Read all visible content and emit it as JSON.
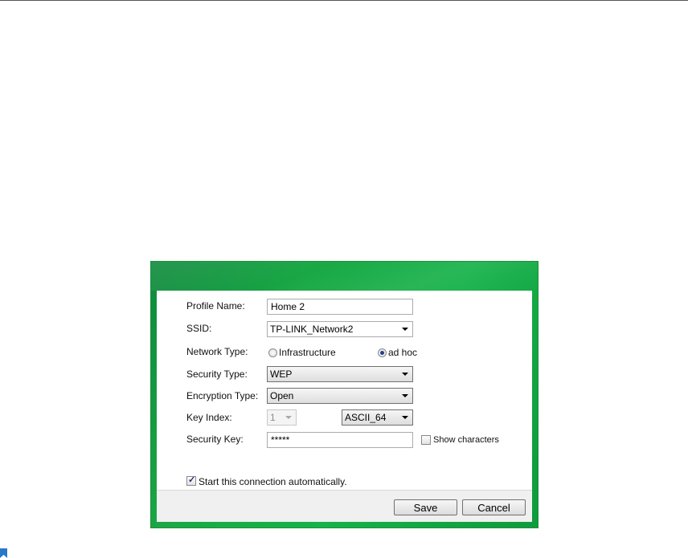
{
  "form": {
    "profile_name_label": "Profile Name:",
    "profile_name_value": "Home 2",
    "ssid_label": "SSID:",
    "ssid_value": "TP-LINK_Network2",
    "network_type_label": "Network Type:",
    "network_type_options": [
      "Infrastructure",
      "ad hoc"
    ],
    "network_type_selected": "ad hoc",
    "security_type_label": "Security Type:",
    "security_type_value": "WEP",
    "encryption_type_label": "Encryption Type:",
    "encryption_type_value": "Open",
    "key_index_label": "Key Index:",
    "key_index_value": "1",
    "key_format_value": "ASCII_64",
    "security_key_label": "Security Key:",
    "security_key_value": "*****",
    "show_characters_label": "Show characters",
    "show_characters_checked": false,
    "auto_start_label": "Start this connection automatically.",
    "auto_start_checked": true
  },
  "buttons": {
    "save_label": "Save",
    "cancel_label": "Cancel"
  },
  "colors": {
    "dialog_green": "#16b24a",
    "radio_selected": "#1f3f8f",
    "bookmark_blue": "#2a78c8"
  }
}
